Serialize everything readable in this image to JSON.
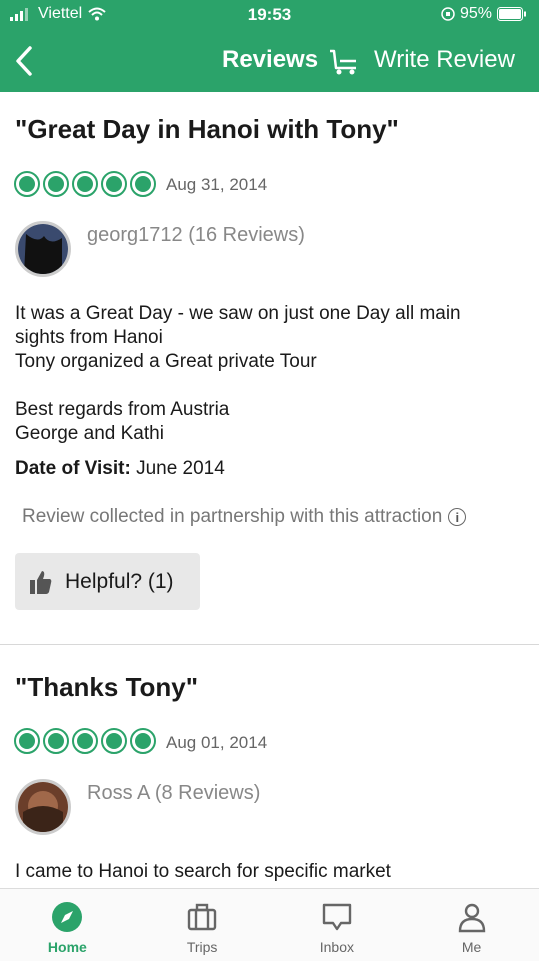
{
  "status": {
    "carrier": "Viettel",
    "time": "19:53",
    "battery": "95%"
  },
  "nav": {
    "title": "Reviews",
    "write_review": "Write Review"
  },
  "reviews": [
    {
      "title": "\"Great Day in Hanoi with Tony\"",
      "rating": 5,
      "date": "Aug 31, 2014",
      "author": "georg1712 (16 Reviews)",
      "body": "It was a Great Day - we saw on just one Day all main sights from Hanoi\nTony organized a Great private Tour\n\nBest regards from Austria\nGeorge and Kathi",
      "visit_label": "Date of Visit:",
      "visit_value": "June 2014",
      "collected": "Review collected in partnership with this attraction",
      "helpful": "Helpful? (1)"
    },
    {
      "title": "\"Thanks Tony\"",
      "rating": 5,
      "date": "Aug 01, 2014",
      "author": "Ross A (8 Reviews)",
      "body": "I came to Hanoi to search for specific market"
    }
  ],
  "tabs": [
    {
      "label": "Home",
      "icon": "compass-icon",
      "active": true
    },
    {
      "label": "Trips",
      "icon": "briefcase-icon",
      "active": false
    },
    {
      "label": "Inbox",
      "icon": "chat-icon",
      "active": false
    },
    {
      "label": "Me",
      "icon": "person-icon",
      "active": false
    }
  ],
  "colors": {
    "brand": "#2ba36a"
  }
}
